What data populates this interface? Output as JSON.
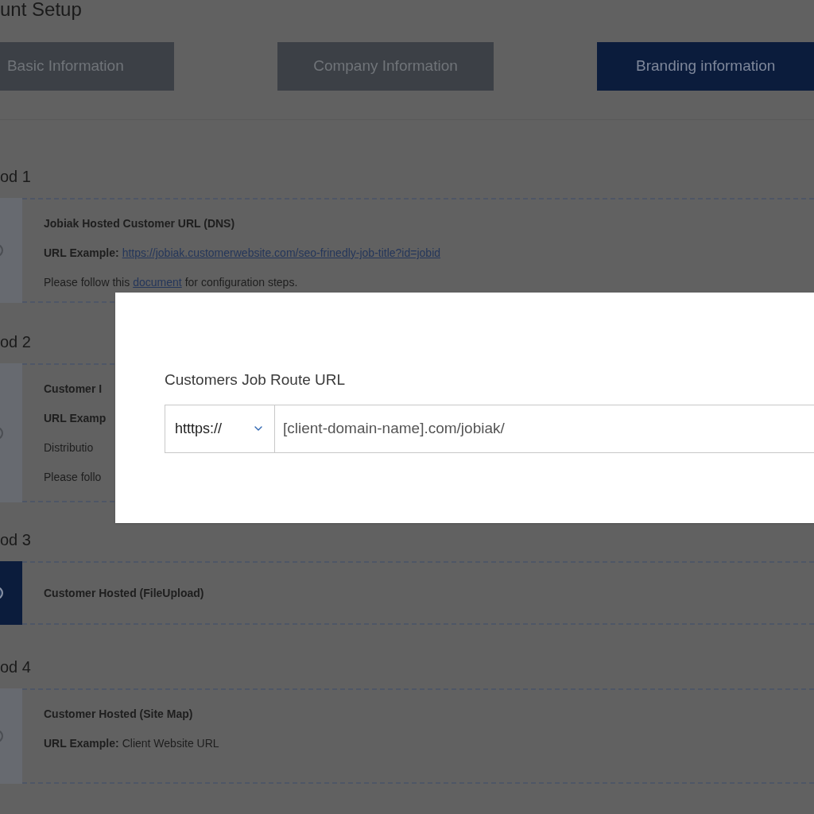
{
  "page": {
    "title": "unt Setup"
  },
  "tabs": [
    {
      "label": "Basic Information",
      "selected": false
    },
    {
      "label": "Company Information",
      "selected": false
    },
    {
      "label": "Branding information",
      "selected": true
    }
  ],
  "methods": [
    {
      "heading": "od 1",
      "selected": false,
      "lines": [
        {
          "kind": "title",
          "text": "Jobiak Hosted Customer URL (DNS)"
        },
        {
          "kind": "example",
          "label": "URL Example:",
          "link": "https://jobiak.customerwebsite.com/seo-frinedly-job-title?id=jobid"
        },
        {
          "kind": "note",
          "before": "Please follow this",
          "link": "document",
          "after": "for configuration steps."
        }
      ]
    },
    {
      "heading": "od 2",
      "selected": false,
      "lines": [
        {
          "kind": "title",
          "text": "Customer I"
        },
        {
          "kind": "title",
          "text": "URL Examp"
        },
        {
          "kind": "plain",
          "text": "Distributio"
        },
        {
          "kind": "plain",
          "text": "Please follo"
        }
      ]
    },
    {
      "heading": "od 3",
      "selected": true,
      "lines": [
        {
          "kind": "title",
          "text": "Customer Hosted (FileUpload)"
        }
      ]
    },
    {
      "heading": "od 4",
      "selected": false,
      "lines": [
        {
          "kind": "title",
          "text": "Customer Hosted (Site Map)"
        },
        {
          "kind": "example",
          "label": "URL Example:",
          "value": "Client Website URL"
        }
      ]
    }
  ],
  "modal": {
    "label": "Customers Job Route URL",
    "protocol": "htttps://",
    "value": "[client-domain-name].com/jobiak/"
  }
}
